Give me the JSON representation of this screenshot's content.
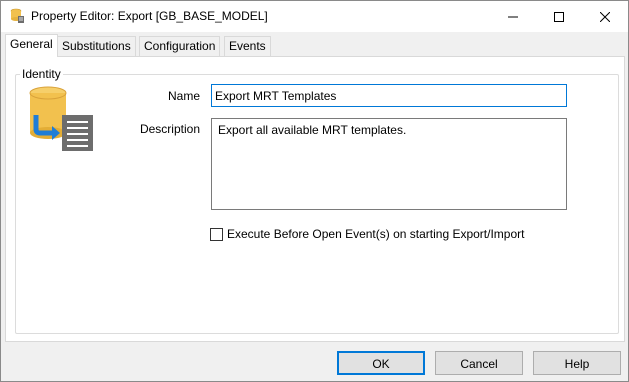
{
  "window": {
    "title": "Property Editor: Export [GB_BASE_MODEL]"
  },
  "tabs": [
    {
      "label": "General",
      "active": true
    },
    {
      "label": "Substitutions",
      "active": false
    },
    {
      "label": "Configuration",
      "active": false
    },
    {
      "label": "Events",
      "active": false
    }
  ],
  "identity": {
    "legend": "Identity",
    "icon": "database-export-icon",
    "name_label": "Name",
    "name_value": "Export MRT Templates",
    "description_label": "Description",
    "description_value": "Export all available MRT templates."
  },
  "options": {
    "execute_before_open_label": "Execute Before Open Event(s) on starting Export/Import",
    "execute_before_open_checked": false
  },
  "buttons": {
    "ok": "OK",
    "cancel": "Cancel",
    "help": "Help"
  },
  "colors": {
    "accent": "#0078d7",
    "db_gold": "#f2c14e",
    "arrow_blue": "#1f7dd6",
    "doc_gray": "#6d6d6d"
  }
}
